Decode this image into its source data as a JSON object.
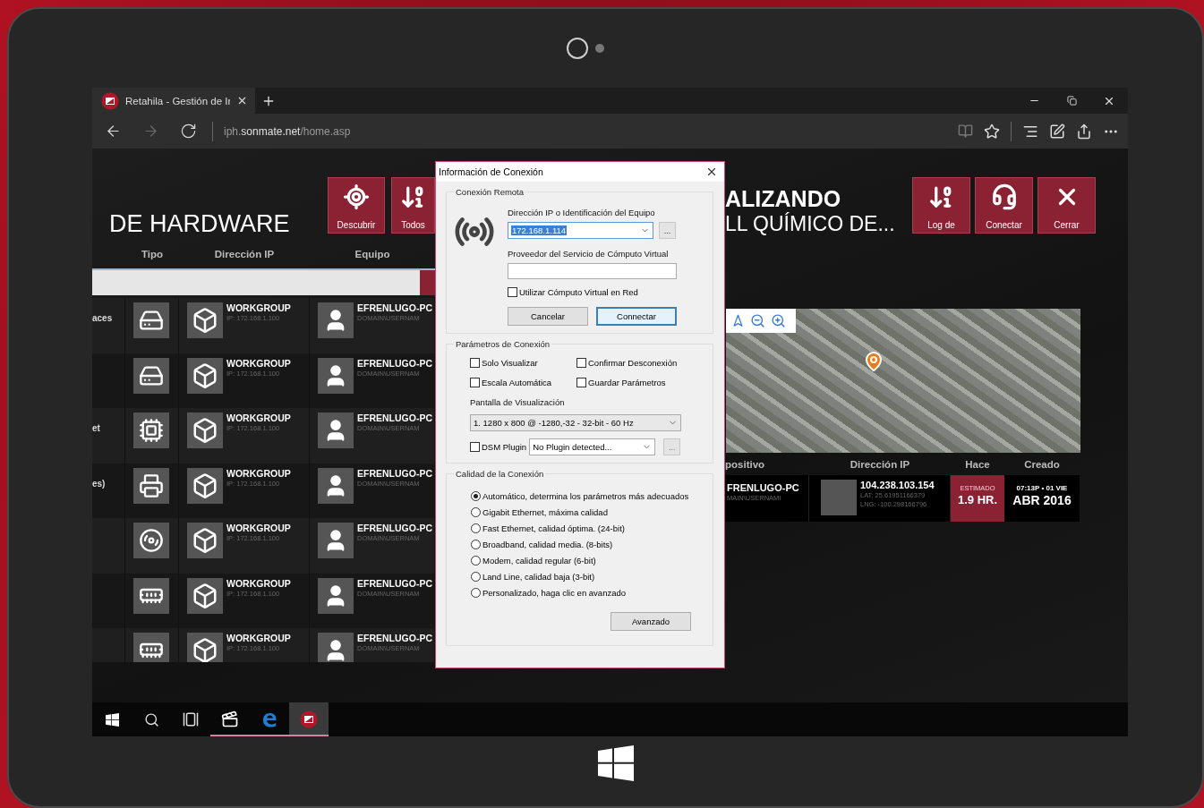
{
  "browser": {
    "tab": {
      "title": "Retahila - Gestión de Ir"
    },
    "nav": [
      {
        "kind": "back",
        "disabled": false
      },
      {
        "kind": "forward",
        "disabled": true
      },
      {
        "kind": "refresh",
        "disabled": false
      }
    ],
    "address": "iph.**sonmate.net**/home.asp"
  },
  "left": {
    "title": "DE HARDWARE",
    "actions": [
      {
        "kind": "discover",
        "label": "Descubrir"
      },
      {
        "kind": "sort",
        "label": "Todos"
      }
    ],
    "columns": [
      "Tipo",
      "Dirección IP",
      "Equipo"
    ],
    "rows": [
      {
        "label": "aces",
        "kind": "disk",
        "group": "WORKGROUP",
        "ip": "IP: 172.168.1.100",
        "computer": "EFRENLUGO-PC",
        "user": "DOMAIN\\USERNAM"
      },
      {
        "kind": "disk",
        "group": "WORKGROUP",
        "ip": "IP: 172.168.1.100",
        "computer": "EFRENLUGO-PC",
        "user": "DOMAIN\\USERNAM"
      },
      {
        "label": "et",
        "kind": "chip",
        "group": "WORKGROUP",
        "ip": "IP: 172.168.1.100",
        "computer": "EFRENLUGO-PC",
        "user": "DOMAIN\\USERNAM"
      },
      {
        "label": "es)",
        "kind": "printer",
        "group": "WORKGROUP",
        "ip": "IP: 172.168.1.100",
        "computer": "EFRENLUGO-PC",
        "user": "DOMAIN\\USERNAM"
      },
      {
        "kind": "disc",
        "group": "WORKGROUP",
        "ip": "IP: 172.168.1.100",
        "computer": "EFRENLUGO-PC",
        "user": "DOMAIN\\USERNAM"
      },
      {
        "kind": "card",
        "group": "WORKGROUP",
        "ip": "IP: 172.168.1.100",
        "computer": "EFRENLUGO-PC",
        "user": "DOMAIN\\USERNAM"
      },
      {
        "kind": "card",
        "group": "WORKGROUP",
        "ip": "IP: 172.168.1.100",
        "computer": "EFRENLUGO-PC",
        "user": "DOMAIN\\USERNAM"
      }
    ]
  },
  "dialog": {
    "title": "Información de Conexión",
    "remote": {
      "legend": "Conexión Remota",
      "ip_label": "Dirección IP o Identificación del Equipo",
      "ip_value": "172.168.1.114",
      "browse": "...",
      "provider_label": "Proveedor del Servicio de Cómputo Virtual",
      "virtual": {
        "label": "Utilizar Cómputo Virtual en Red",
        "checked": false
      },
      "buttons": [
        {
          "label": "Cancelar",
          "default": false
        },
        {
          "label": "Connectar",
          "default": true
        }
      ]
    },
    "params": {
      "legend": "Parámetros de Conexión",
      "options": [
        {
          "label": "Solo Visualizar",
          "checked": false
        },
        {
          "label": "Confirmar Desconexión",
          "checked": false
        },
        {
          "label": "Escala Automática",
          "checked": false
        },
        {
          "label": "Guardar Parámetros",
          "checked": false
        }
      ],
      "display_label": "Pantalla de Visualización",
      "display_value": "1. 1280 x 800 @ -1280,-32 - 32-bit - 60 Hz",
      "dsm": {
        "label": "DSM Plugin",
        "checked": false
      },
      "plugin_value": "No Plugin detected...",
      "plugin_button": {
        "label": "...",
        "disabled": true
      }
    },
    "quality": {
      "legend": "Calidad de la Conexión",
      "options": [
        {
          "label": "Automático, determina los parámetros más adecuados",
          "selected": true
        },
        {
          "label": "Gigabit Ethernet, máxima calidad",
          "selected": false
        },
        {
          "label": "Fast Ethernet, calidad óptima. (24-bit)",
          "selected": false
        },
        {
          "label": "Broadband, calidad media. (8-bits)",
          "selected": false
        },
        {
          "label": "Modem, calidad regular (6-bit)",
          "selected": false
        },
        {
          "label": "Land Line, calidad baja (3-bit)",
          "selected": false
        },
        {
          "label": "Personalizado, haga clic en avanzado",
          "selected": false
        }
      ],
      "advanced": "Avanzado"
    }
  },
  "right": {
    "title": [
      "ALIZANDO",
      "LL QUÍMICO DE..."
    ],
    "actions": [
      {
        "kind": "sort",
        "label": "Log de"
      },
      {
        "kind": "agent",
        "label": "Conectar"
      },
      {
        "kind": "close",
        "label": "Cerrar"
      }
    ],
    "columns": [
      "positivo",
      "Dirección IP",
      "Hace",
      "Creado"
    ],
    "record": {
      "device": "FRENLUGO-PC",
      "user": "MAIN\\USERNAMI",
      "ip": "104.238.103.154",
      "lat": "LAT: 25.61951166379",
      "lng": "LNG: -100.298166796",
      "estimate_label": "ESTIMADO",
      "estimate_value": "1.9 HR.",
      "created_time": "07:13P • 01 VIE",
      "created_date": "ABR 2016"
    }
  },
  "taskbar": [
    {
      "kind": "start",
      "running": false,
      "active": false
    },
    {
      "kind": "search",
      "running": false,
      "active": false
    },
    {
      "kind": "taskview",
      "running": false,
      "active": false
    },
    {
      "kind": "clapper",
      "running": true,
      "active": false
    },
    {
      "kind": "browser",
      "running": true,
      "active": false
    },
    {
      "kind": "app",
      "running": true,
      "active": true
    }
  ]
}
